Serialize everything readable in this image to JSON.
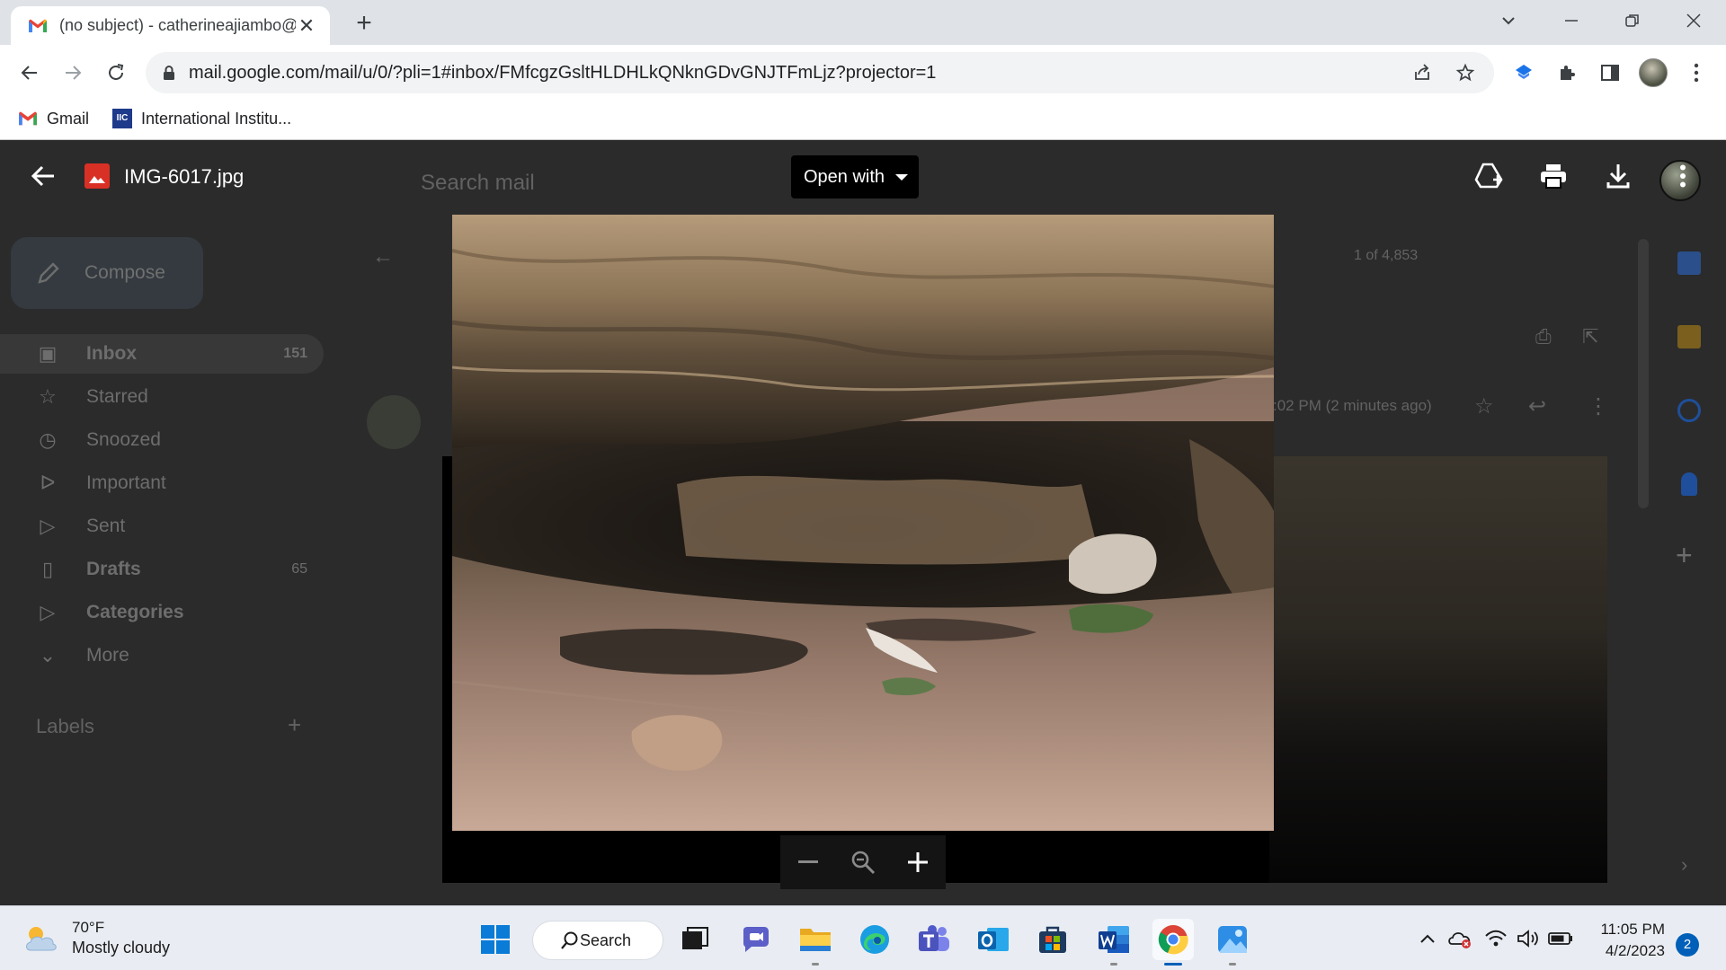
{
  "browser": {
    "tab_title": "(no subject) - catherineajiambo@",
    "url": "mail.google.com/mail/u/0/?pli=1#inbox/FMfcgzGsltHLDHLkQNknGDvGNJTFmLjz?projector=1",
    "bookmarks": [
      {
        "label": "Gmail",
        "icon": "gmail-icon"
      },
      {
        "label": "International Institu...",
        "icon": "iic-icon"
      }
    ]
  },
  "gmail": {
    "search_placeholder": "Search mail",
    "compose_label": "Compose",
    "sidebar": [
      {
        "label": "Inbox",
        "count": "151",
        "icon": "inbox-icon",
        "bold": true
      },
      {
        "label": "Starred",
        "count": "",
        "icon": "star-icon"
      },
      {
        "label": "Snoozed",
        "count": "",
        "icon": "clock-icon"
      },
      {
        "label": "Important",
        "count": "",
        "icon": "important-icon"
      },
      {
        "label": "Sent",
        "count": "",
        "icon": "send-icon"
      },
      {
        "label": "Drafts",
        "count": "65",
        "icon": "draft-icon",
        "bold": true
      },
      {
        "label": "Categories",
        "count": "",
        "icon": "label-icon",
        "bold": true
      },
      {
        "label": "More",
        "count": "",
        "icon": "chevron-down-icon"
      }
    ],
    "labels_heading": "Labels",
    "pagination": "1 of 4,853",
    "message_time": ":02 PM (2 minutes ago)"
  },
  "viewer": {
    "file_name": "IMG-6017.jpg",
    "open_with_label": "Open with"
  },
  "taskbar": {
    "weather_temp": "70°F",
    "weather_desc": "Mostly cloudy",
    "search_label": "Search",
    "time": "11:05 PM",
    "date": "4/2/2023",
    "notification_count": "2"
  },
  "colors": {
    "gmail_red": "#d93025",
    "chrome_blue": "#1a73e8",
    "windows_blue": "#005fb8"
  }
}
